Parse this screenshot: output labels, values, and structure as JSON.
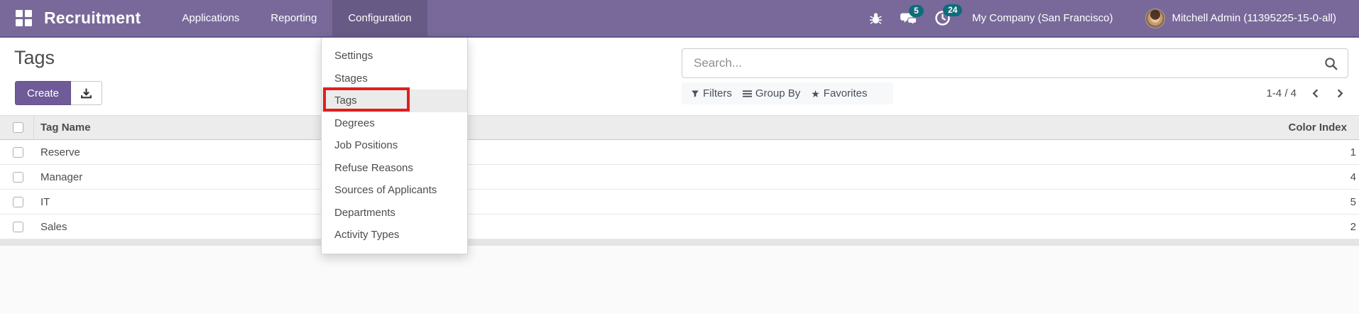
{
  "colors": {
    "navbar_bg": "#78699a",
    "navbar_active_bg": "#675a84",
    "create_button_bg": "#6e5b97",
    "badge_bg": "#0e6d78",
    "annotation_red": "#e01e1e"
  },
  "navbar": {
    "brand": "Recruitment",
    "menus": [
      "Applications",
      "Reporting",
      "Configuration"
    ],
    "active_menu": "Configuration",
    "systray": {
      "message_badge": "5",
      "activity_badge": "24",
      "company": "My Company (San Francisco)",
      "user": "Mitchell Admin (11395225-15-0-all)"
    }
  },
  "page": {
    "title": "Tags",
    "create_label": "Create",
    "search": {
      "placeholder": "Search..."
    },
    "filters": {
      "filters_label": "Filters",
      "group_by_label": "Group By",
      "favorites_label": "Favorites"
    },
    "pager": {
      "range": "1-4 / 4"
    }
  },
  "config_menu": {
    "items": [
      "Settings",
      "Stages",
      "Tags",
      "Degrees",
      "Job Positions",
      "Refuse Reasons",
      "Sources of Applicants",
      "Departments",
      "Activity Types"
    ],
    "active_item": "Tags"
  },
  "table": {
    "columns": {
      "name": "Tag Name",
      "color_index": "Color Index"
    },
    "rows": [
      {
        "name": "Reserve",
        "color_index": "1"
      },
      {
        "name": "Manager",
        "color_index": "4"
      },
      {
        "name": "IT",
        "color_index": "5"
      },
      {
        "name": "Sales",
        "color_index": "2"
      }
    ]
  }
}
